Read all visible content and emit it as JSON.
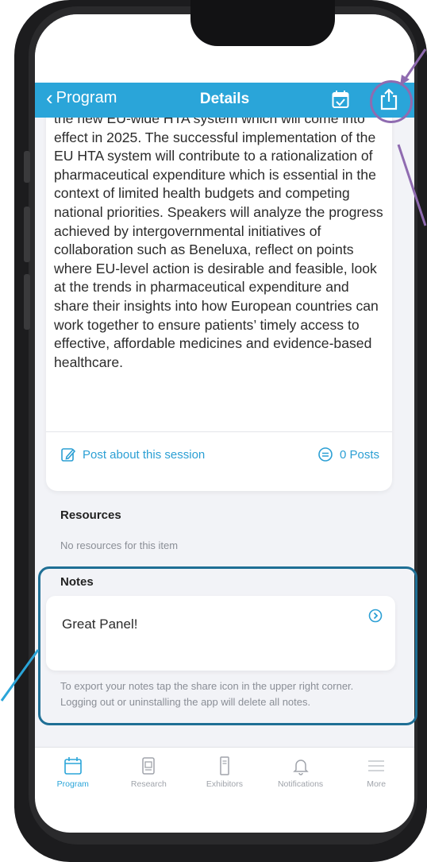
{
  "navbar": {
    "back_label": "Program",
    "title": "Details"
  },
  "session": {
    "description": "the new EU-wide HTA system which will come into effect in 2025. The successful implementation of the EU HTA system will contribute to a rationalization of pharmaceutical expenditure which is essential in the context of limited health budgets and competing national priorities. Speakers will analyze the progress achieved by intergovernmental initiatives of collaboration such as Beneluxa, reflect on points where EU-level action is desirable and feasible, look at the trends in pharmaceutical expenditure and share their insights into how European countries can work together to ensure patients’ timely access to effective, affordable medicines and evidence-based healthcare.",
    "post_label": "Post about this session",
    "posts_count_label": "0 Posts"
  },
  "resources": {
    "title": "Resources",
    "empty_text": "No resources for this item"
  },
  "notes": {
    "title": "Notes",
    "note_text": "Great Panel!",
    "hint": "To export your notes tap the share icon in the upper right corner. Logging out or uninstalling the app will delete all notes."
  },
  "tabbar": {
    "items": [
      {
        "label": "Program",
        "icon": "calendar-icon",
        "active": true
      },
      {
        "label": "Research",
        "icon": "document-icon",
        "active": false
      },
      {
        "label": "Exhibitors",
        "icon": "booth-icon",
        "active": false
      },
      {
        "label": "Notifications",
        "icon": "bell-icon",
        "active": false
      },
      {
        "label": "More",
        "icon": "menu-icon",
        "active": false
      }
    ]
  },
  "colors": {
    "accent": "#2aa5d9",
    "link": "#2b9fd4",
    "highlight_notes": "#1f6f95",
    "highlight_share": "#8f6bb0"
  }
}
